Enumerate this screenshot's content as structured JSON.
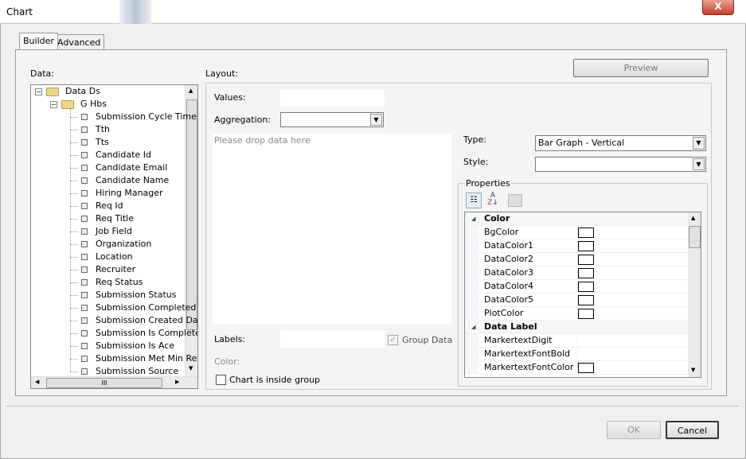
{
  "window": {
    "title": "Chart",
    "close_label": "X"
  },
  "tabs": [
    {
      "label": "Builder",
      "selected": true
    },
    {
      "label": "Advanced",
      "selected": false
    }
  ],
  "data_panel": {
    "label": "Data:",
    "root": "Data Ds",
    "group": "G Hbs",
    "fields": [
      "Submission Cycle Time",
      "Tth",
      "Tts",
      "Candidate Id",
      "Candidate Email",
      "Candidate Name",
      "Hiring Manager",
      "Req Id",
      "Req Title",
      "Job Field",
      "Organization",
      "Location",
      "Recruiter",
      "Req Status",
      "Submission Status",
      "Submission Completed I",
      "Submission Created Da",
      "Submission Is Complete",
      "Submission Is Ace",
      "Submission Met Min Rec",
      "Submission Source"
    ],
    "hscroll_grip": "III"
  },
  "layout": {
    "label": "Layout:",
    "preview_label": "Preview",
    "values_label": "Values:",
    "values_value": "",
    "aggregation_label": "Aggregation:",
    "aggregation_value": "",
    "drop_placeholder": "Please drop data here",
    "labels_label": "Labels:",
    "labels_value": "",
    "group_data_label": "Group Data",
    "group_data_checked": true,
    "color_label": "Color:",
    "inside_group_label": "Chart is inside group",
    "inside_group_checked": false,
    "type_label": "Type:",
    "type_value": "Bar Graph - Vertical",
    "style_label": "Style:",
    "style_value": "",
    "properties_label": "Properties"
  },
  "properties": [
    {
      "category": "Color",
      "items": [
        {
          "name": "BgColor",
          "swatch": "#ffffff"
        },
        {
          "name": "DataColor1",
          "swatch": "#ffffff"
        },
        {
          "name": "DataColor2",
          "swatch": "#ffffff"
        },
        {
          "name": "DataColor3",
          "swatch": "#ffffff"
        },
        {
          "name": "DataColor4",
          "swatch": "#ffffff"
        },
        {
          "name": "DataColor5",
          "swatch": "#ffffff"
        },
        {
          "name": "PlotColor",
          "swatch": "#ffffff"
        }
      ]
    },
    {
      "category": "Data Label",
      "items": [
        {
          "name": "MarkertextDigit"
        },
        {
          "name": "MarkertextFontBold"
        },
        {
          "name": "MarkertextFontColor",
          "swatch": "#ffffff"
        }
      ]
    }
  ],
  "footer": {
    "ok_label": "OK",
    "cancel_label": "Cancel"
  }
}
